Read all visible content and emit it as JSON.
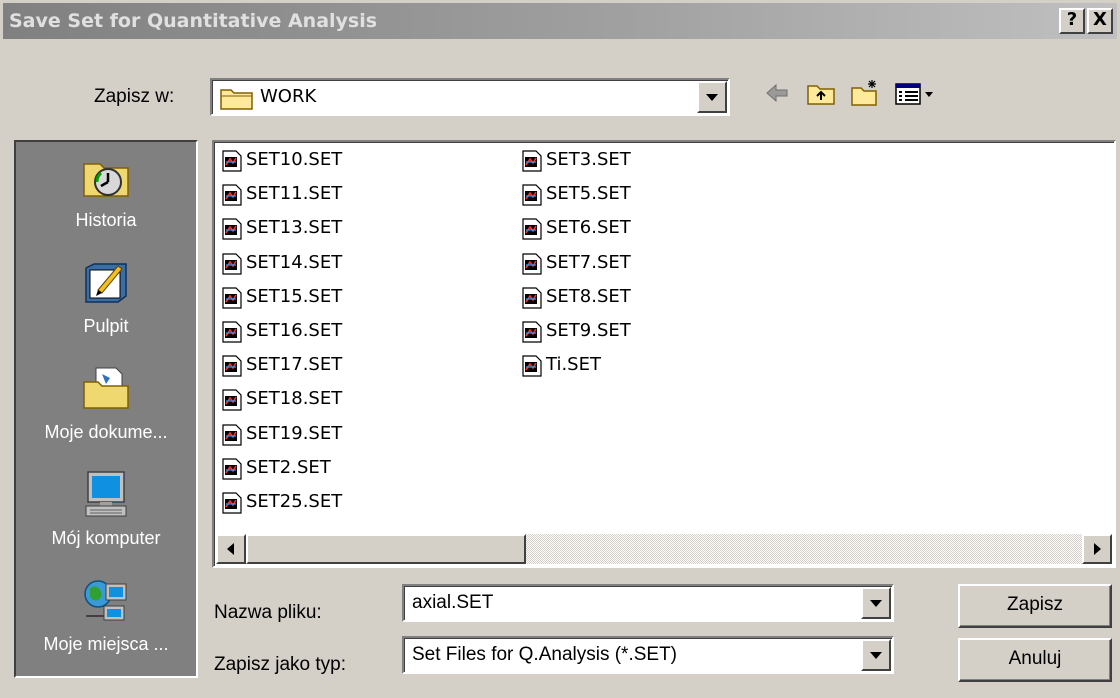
{
  "window": {
    "title": "Save Set for Quantitative Analysis",
    "help": "?",
    "close": "X"
  },
  "toolbar": {
    "lookin_label": "Zapisz w:",
    "lookin_value": "WORK"
  },
  "places": [
    {
      "label": "Historia",
      "icon": "history-icon"
    },
    {
      "label": "Pulpit",
      "icon": "desktop-icon"
    },
    {
      "label": "Moje dokume...",
      "icon": "my-documents-icon"
    },
    {
      "label": "Mój komputer",
      "icon": "my-computer-icon"
    },
    {
      "label": "Moje miejsca ...",
      "icon": "network-places-icon"
    }
  ],
  "files": {
    "column1": [
      "SET10.SET",
      "SET11.SET",
      "SET13.SET",
      "SET14.SET",
      "SET15.SET",
      "SET16.SET",
      "SET17.SET",
      "SET18.SET",
      "SET19.SET",
      "SET2.SET",
      "SET25.SET"
    ],
    "column2": [
      "SET3.SET",
      "SET5.SET",
      "SET6.SET",
      "SET7.SET",
      "SET8.SET",
      "SET9.SET",
      "Ti.SET"
    ]
  },
  "form": {
    "filename_label": "Nazwa pliku:",
    "filename_value": "axial.SET",
    "filetype_label": "Zapisz jako typ:",
    "filetype_value": "Set Files for Q.Analysis (*.SET)"
  },
  "buttons": {
    "save": "Zapisz",
    "cancel": "Anuluj"
  },
  "colors": {
    "face": "#d4d0c8",
    "places_bg": "#808080",
    "title_gradient_start": "#808080"
  }
}
